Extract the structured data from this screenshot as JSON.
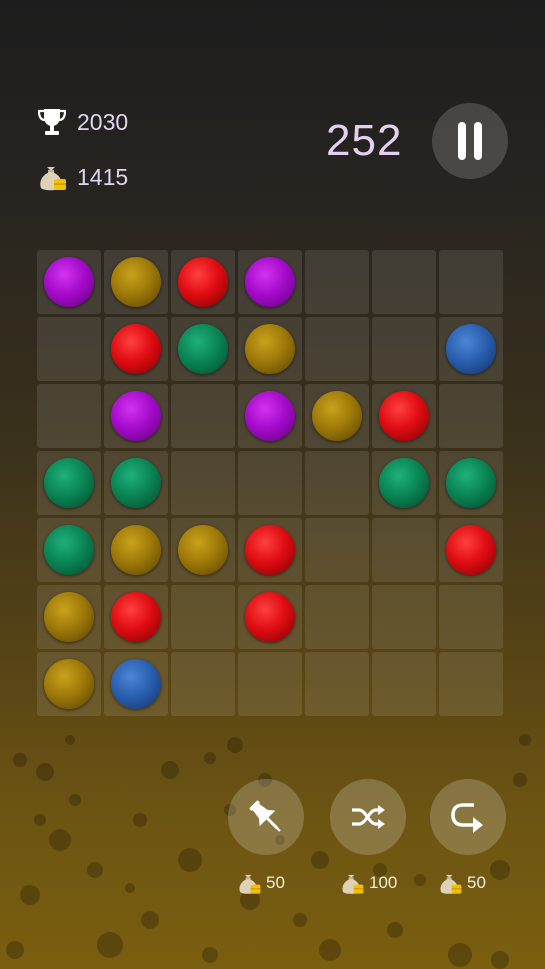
{
  "hud": {
    "best_score": "2030",
    "coins": "1415",
    "current_score": "252"
  },
  "board": {
    "rows": [
      [
        "purple",
        "gold",
        "red",
        "purple",
        "",
        "",
        ""
      ],
      [
        "",
        "red",
        "green",
        "gold",
        "",
        "",
        "blue"
      ],
      [
        "",
        "purple",
        "",
        "purple",
        "gold",
        "red",
        ""
      ],
      [
        "green",
        "green",
        "",
        "",
        "",
        "green",
        "green"
      ],
      [
        "green",
        "gold",
        "gold",
        "red",
        "",
        "",
        "red"
      ],
      [
        "gold",
        "red",
        "",
        "red",
        "",
        "",
        ""
      ],
      [
        "gold",
        "blue",
        "",
        "",
        "",
        "",
        ""
      ]
    ]
  },
  "tools": [
    {
      "icon": "pin-icon",
      "cost": "50"
    },
    {
      "icon": "shuffle-icon",
      "cost": "100"
    },
    {
      "icon": "undo-icon",
      "cost": "50"
    }
  ],
  "colors": {
    "purple": "#a60bcc",
    "gold": "#9f7a0a",
    "red": "#e00d12",
    "green": "#0a8655",
    "blue": "#2a60b0",
    "score_text": "#e4cff0"
  }
}
